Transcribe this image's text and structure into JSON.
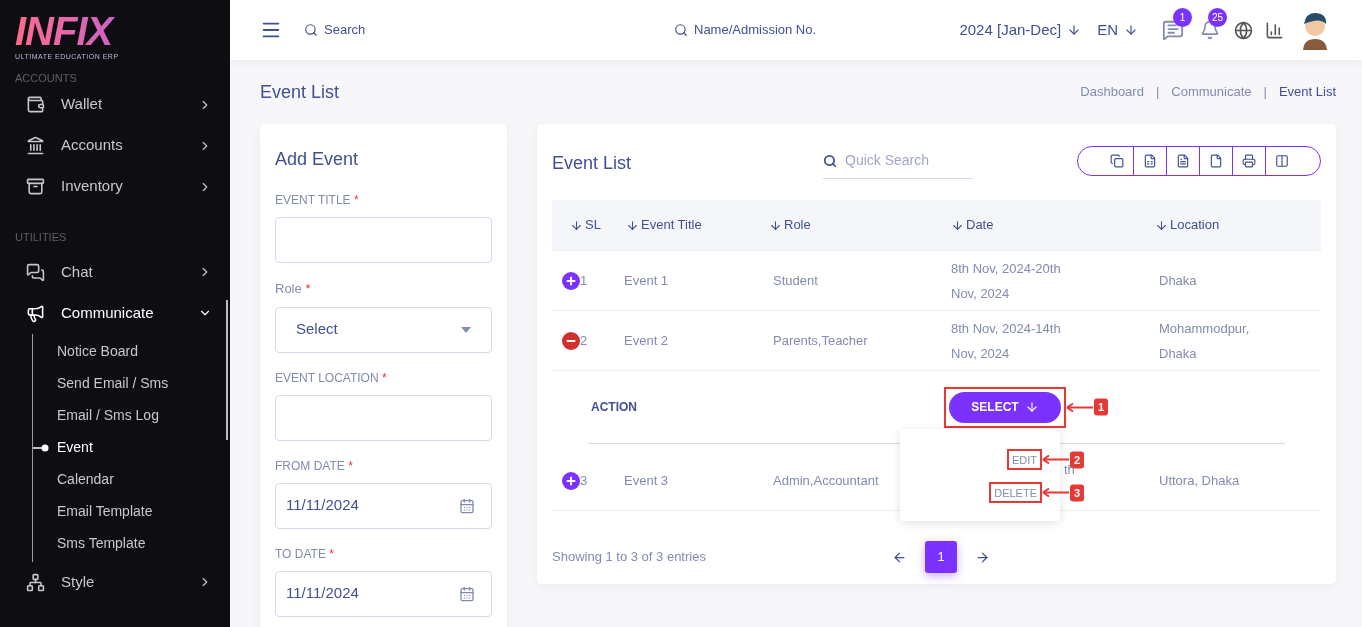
{
  "sidebar": {
    "logo": "INFIX",
    "tagline": "ULTIMATE EDUCATION ERP",
    "sections": [
      {
        "heading": "ACCOUNTS",
        "items": [
          {
            "label": "Wallet",
            "expanded": false
          },
          {
            "label": "Accounts",
            "expanded": false
          },
          {
            "label": "Inventory",
            "expanded": false
          }
        ]
      },
      {
        "heading": "UTILITIES",
        "items": [
          {
            "label": "Chat",
            "expanded": false
          },
          {
            "label": "Communicate",
            "expanded": true,
            "children": [
              {
                "label": "Notice Board",
                "selected": false
              },
              {
                "label": "Send Email / Sms",
                "selected": false
              },
              {
                "label": "Email / Sms Log",
                "selected": false
              },
              {
                "label": "Event",
                "selected": true
              },
              {
                "label": "Calendar",
                "selected": false
              },
              {
                "label": "Email Template",
                "selected": false
              },
              {
                "label": "Sms Template",
                "selected": false
              }
            ]
          },
          {
            "label": "Style",
            "expanded": false
          }
        ]
      }
    ]
  },
  "header": {
    "search": "Search",
    "student_search": "Name/Admission No.",
    "session": "2024 [Jan-Dec]",
    "language": "EN",
    "chat_badge": "1",
    "notification_badge": "25"
  },
  "page": {
    "title": "Event List",
    "breadcrumb": [
      {
        "label": "Dashboard",
        "selected": false
      },
      {
        "label": "Communicate",
        "selected": false
      },
      {
        "label": "Event List",
        "selected": true
      }
    ],
    "separator": "|"
  },
  "form": {
    "title": "Add Event",
    "fields": [
      {
        "label": "EVENT TITLE",
        "mark": "*",
        "kind": "text"
      },
      {
        "label": "Role",
        "mark": "*",
        "kind": "select",
        "value": "Select"
      },
      {
        "label": "EVENT LOCATION",
        "mark": "*",
        "kind": "text"
      },
      {
        "label": "FROM DATE",
        "mark": "*",
        "kind": "date",
        "value": "11/11/2024"
      },
      {
        "label": "TO DATE",
        "mark": "*",
        "kind": "date",
        "value": "11/11/2024"
      }
    ]
  },
  "list": {
    "title": "Event List",
    "search_placeholder": "Quick Search",
    "columns": [
      "SL",
      "Event Title",
      "Role",
      "Date",
      "Location"
    ],
    "rows": [
      {
        "sl": "1",
        "expanded": false,
        "title": "Event 1",
        "role": "Student",
        "date": "8th Nov, 2024-20th Nov, 2024",
        "location": "Dhaka"
      },
      {
        "sl": "2",
        "expanded": true,
        "title": "Event 2",
        "role": "Parents,Teacher",
        "date": "8th Nov, 2024-14th Nov, 2024",
        "location": "Mohammodpur, Dhaka",
        "detail": {
          "label": "ACTION",
          "button": "SELECT",
          "callout": "1",
          "menu": [
            {
              "label": "EDIT",
              "callout": "2"
            },
            {
              "label": "DELETE",
              "callout": "3"
            }
          ]
        }
      },
      {
        "sl": "3",
        "expanded": false,
        "title": "Event 3",
        "role": "Admin,Accountant",
        "date": "th",
        "location": "Uttora, Dhaka"
      }
    ],
    "footer": "Showing 1 to 3 of 3 entries",
    "pages": [
      {
        "label": "1",
        "selected": true
      }
    ]
  }
}
